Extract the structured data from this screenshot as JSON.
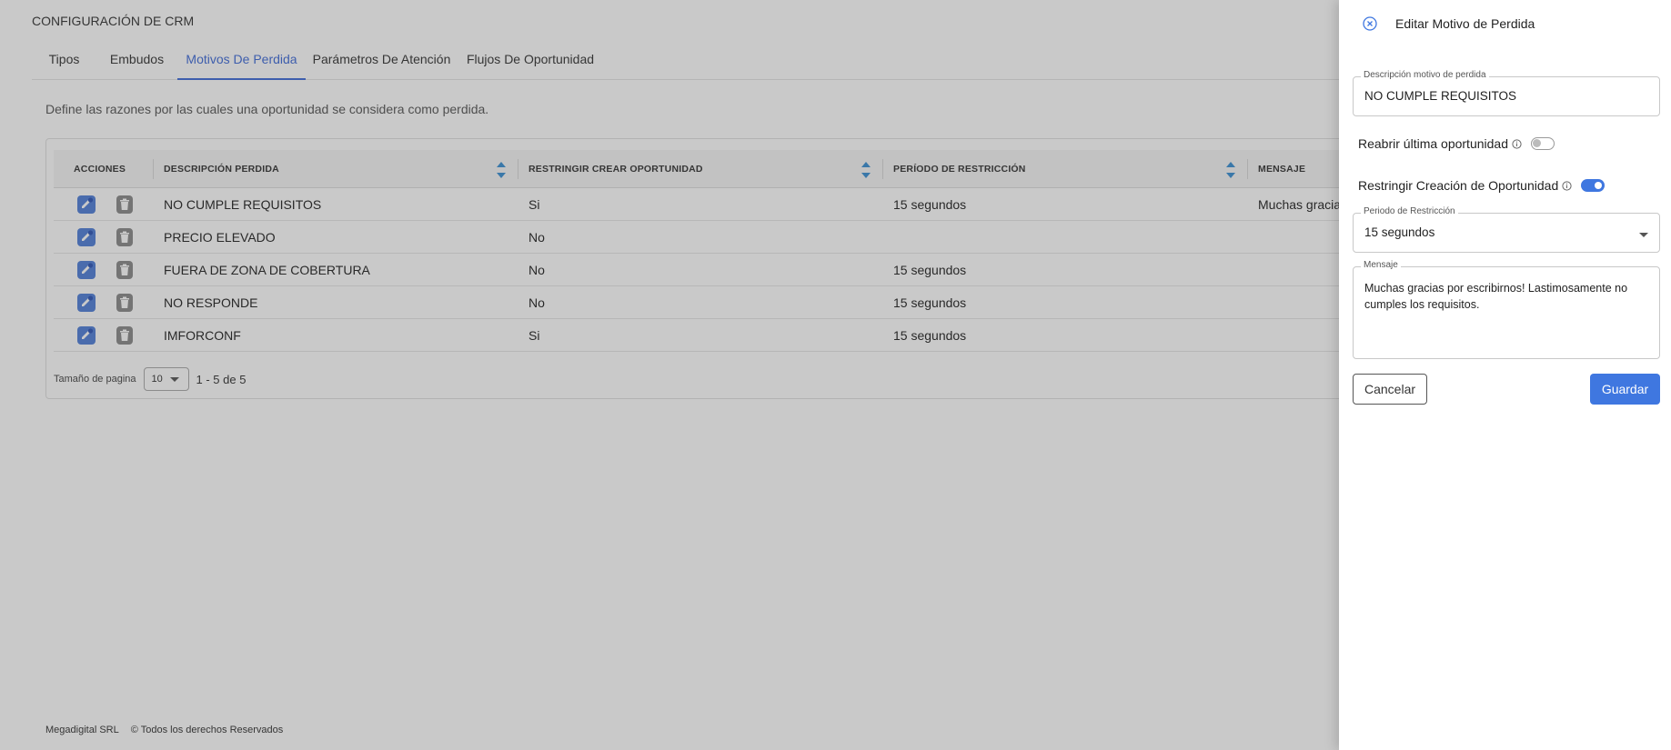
{
  "page": {
    "title": "CONFIGURACIÓN DE CRM",
    "description": "Define las razones por las cuales una oportunidad se considera como perdida."
  },
  "tabs": [
    {
      "label": "Tipos",
      "active": false
    },
    {
      "label": "Embudos",
      "active": false
    },
    {
      "label": "Motivos De Perdida",
      "active": true
    },
    {
      "label": "Parámetros De Atención",
      "active": false
    },
    {
      "label": "Flujos De Oportunidad",
      "active": false
    }
  ],
  "table": {
    "headers": [
      "ACCIONES",
      "DESCRIPCIÓN PERDIDA",
      "RESTRINGIR CREAR OPORTUNIDAD",
      "PERÍODO DE RESTRICCIÓN",
      "MENSAJE"
    ],
    "rows": [
      {
        "descripcion": "NO CUMPLE REQUISITOS",
        "restringir": "Si",
        "periodo": "15 segundos",
        "mensaje": "Muchas gracias"
      },
      {
        "descripcion": "PRECIO ELEVADO",
        "restringir": "No",
        "periodo": "",
        "mensaje": ""
      },
      {
        "descripcion": "FUERA DE ZONA DE COBERTURA",
        "restringir": "No",
        "periodo": "15 segundos",
        "mensaje": ""
      },
      {
        "descripcion": "NO RESPONDE",
        "restringir": "No",
        "periodo": "15 segundos",
        "mensaje": ""
      },
      {
        "descripcion": "IMFORCONF",
        "restringir": "Si",
        "periodo": "15 segundos",
        "mensaje": ""
      }
    ],
    "icons": {
      "edit": "edit-icon",
      "delete": "trash-icon",
      "sort": "sort-icon"
    }
  },
  "pagination": {
    "label": "Tamaño de pagina",
    "page_size": "10",
    "range": "1 - 5 de 5"
  },
  "footer": {
    "company": "Megadigital SRL",
    "rights": "© Todos los derechos Reservados"
  },
  "panel": {
    "title": "Editar Motivo de Perdida",
    "description_field": {
      "label": "Descripción motivo de perdida",
      "value": "NO CUMPLE REQUISITOS"
    },
    "reopen_toggle": {
      "label": "Reabrir última oportunidad",
      "on": false
    },
    "restrict_toggle": {
      "label": "Restringir Creación de Oportunidad",
      "on": true
    },
    "period_field": {
      "label": "Periodo de Restricción",
      "value": "15 segundos"
    },
    "message_field": {
      "label": "Mensaje",
      "value": "Muchas gracias por escribirnos! Lastimosamente no cumples los requisitos."
    },
    "cancel_label": "Cancelar",
    "save_label": "Guardar"
  },
  "colors": {
    "accent": "#3f77e0",
    "tab_active": "#3f6bd8",
    "sort_arrow": "#3a8fd3",
    "edit_button": "#4f7fd9",
    "delete_button": "#8a8a8a"
  }
}
